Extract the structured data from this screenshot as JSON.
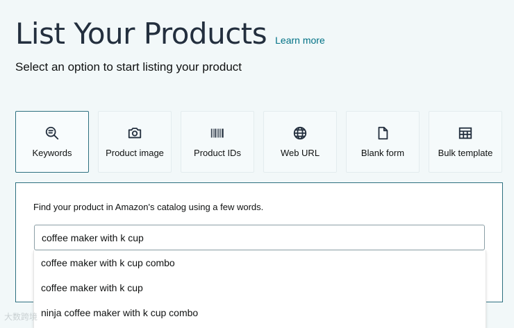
{
  "header": {
    "title": "List Your Products",
    "learn_more": "Learn more",
    "subtitle": "Select an option to start listing your product"
  },
  "options": [
    {
      "label": "Keywords",
      "icon": "keyword-search-icon",
      "selected": true
    },
    {
      "label": "Product image",
      "icon": "camera-icon",
      "selected": false
    },
    {
      "label": "Product IDs",
      "icon": "barcode-icon",
      "selected": false
    },
    {
      "label": "Web URL",
      "icon": "globe-icon",
      "selected": false
    },
    {
      "label": "Blank form",
      "icon": "document-icon",
      "selected": false
    },
    {
      "label": "Bulk template",
      "icon": "spreadsheet-icon",
      "selected": false
    }
  ],
  "search": {
    "instruction": "Find your product in Amazon's catalog using a few words.",
    "value": "coffee maker with k cup",
    "suggestions": [
      "coffee maker with k cup combo",
      "coffee maker with k cup",
      "ninja coffee maker with k cup combo"
    ]
  },
  "watermark": "大数跨境",
  "colors": {
    "accent": "#2c6f7f",
    "link": "#007185",
    "background": "#f2f8f9",
    "title": "#232f3e"
  }
}
